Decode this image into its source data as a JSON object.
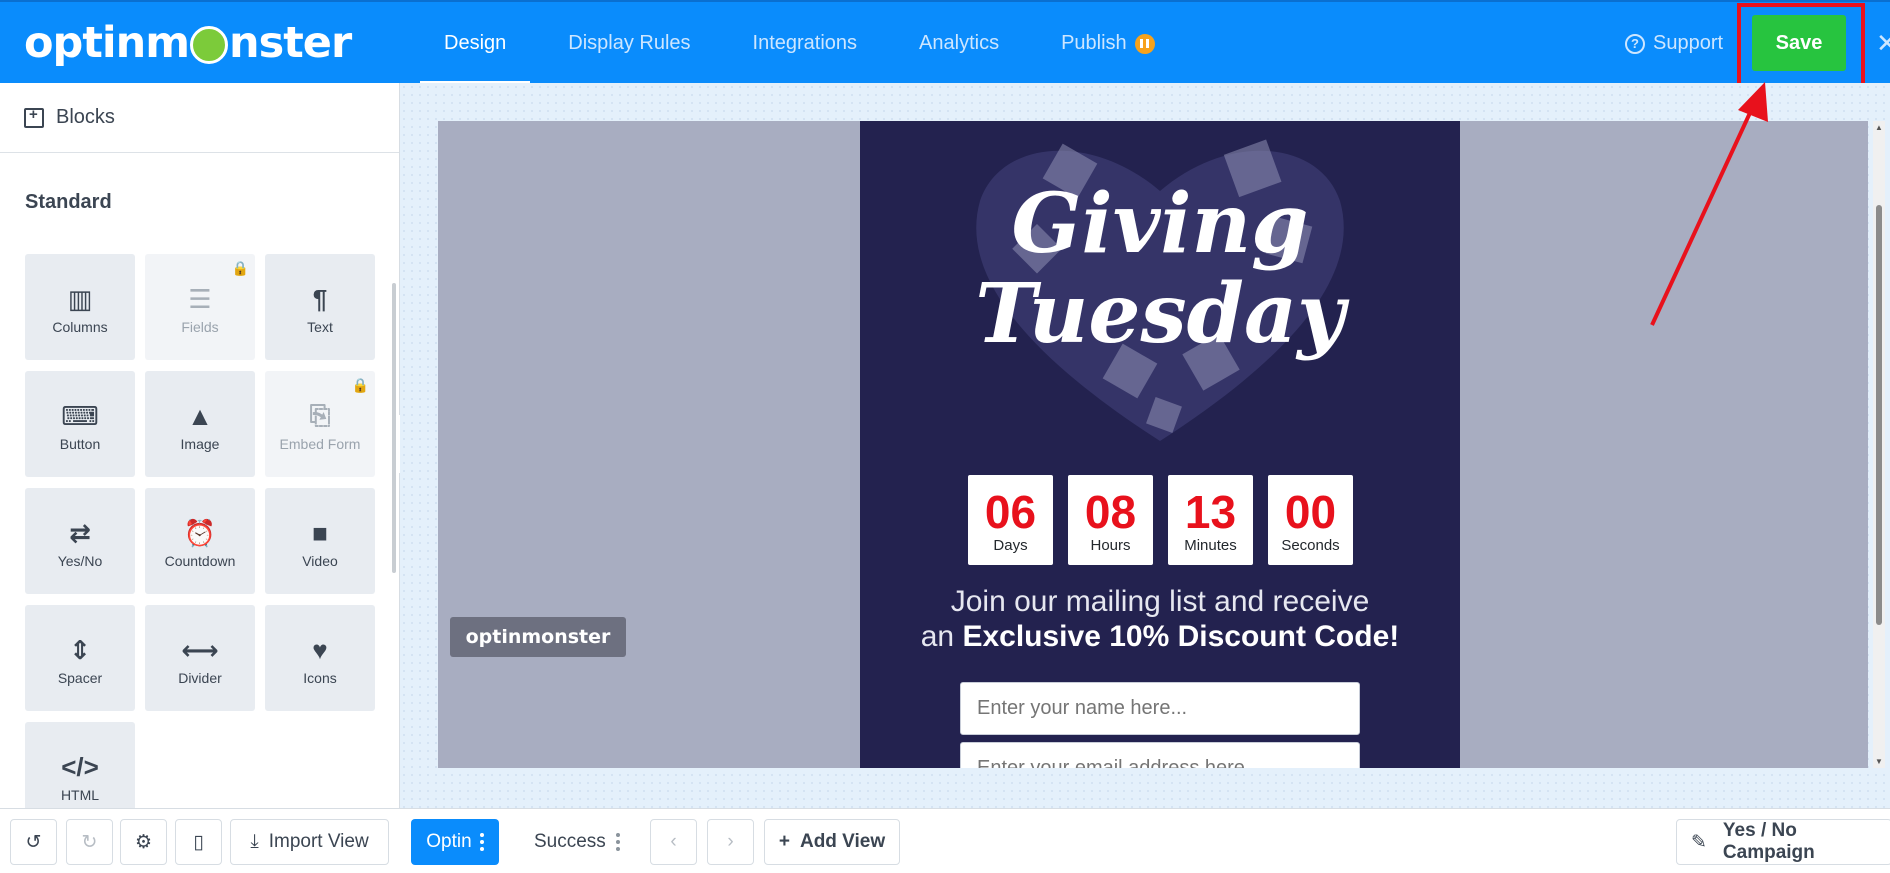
{
  "brand": {
    "logo_text_a": "optinm",
    "logo_text_b": "nster"
  },
  "nav": {
    "tabs": [
      {
        "label": "Design"
      },
      {
        "label": "Display Rules"
      },
      {
        "label": "Integrations"
      },
      {
        "label": "Analytics"
      },
      {
        "label": "Publish"
      }
    ]
  },
  "header": {
    "support_label": "Support",
    "save_label": "Save",
    "close_icon": "✕"
  },
  "sidebar": {
    "heading": "Blocks",
    "section": "Standard",
    "blocks": [
      {
        "label": "Columns",
        "icon": "columns-icon",
        "glyph": "▥",
        "locked": false
      },
      {
        "label": "Fields",
        "icon": "fields-icon",
        "glyph": "☰",
        "locked": true
      },
      {
        "label": "Text",
        "icon": "paragraph-icon",
        "glyph": "¶",
        "locked": false
      },
      {
        "label": "Button",
        "icon": "button-cursor-icon",
        "glyph": "⌨",
        "locked": false
      },
      {
        "label": "Image",
        "icon": "image-icon",
        "glyph": "▲",
        "locked": false
      },
      {
        "label": "Embed Form",
        "icon": "embed-file-icon",
        "glyph": "⎘",
        "locked": true
      },
      {
        "label": "Yes/No",
        "icon": "toggle-icon",
        "glyph": "⇄",
        "locked": false
      },
      {
        "label": "Countdown",
        "icon": "alarm-clock-icon",
        "glyph": "⏰",
        "locked": false
      },
      {
        "label": "Video",
        "icon": "video-camera-icon",
        "glyph": "■",
        "locked": false
      },
      {
        "label": "Spacer",
        "icon": "spacer-icon",
        "glyph": "⇕",
        "locked": false
      },
      {
        "label": "Divider",
        "icon": "divider-icon",
        "glyph": "⟷",
        "locked": false
      },
      {
        "label": "Icons",
        "icon": "heart-circle-icon",
        "glyph": "♥",
        "locked": false
      },
      {
        "label": "HTML",
        "icon": "code-icon",
        "glyph": "</>",
        "locked": false
      }
    ]
  },
  "popup": {
    "title_line1": "Giving",
    "title_line2": "Tuesday",
    "timer": [
      {
        "value": "06",
        "label": "Days"
      },
      {
        "value": "08",
        "label": "Hours"
      },
      {
        "value": "13",
        "label": "Minutes"
      },
      {
        "value": "00",
        "label": "Seconds"
      }
    ],
    "msg_line1": "Join our mailing list and receive",
    "msg_line2_prefix": "an ",
    "msg_line2_bold": "Exclusive 10% Discount Code!",
    "name_placeholder": "Enter your name here...",
    "email_placeholder": "Enter your email address here...",
    "badge_text": "optinmonster"
  },
  "bottom": {
    "import_label": "Import View",
    "optin_label": "Optin",
    "success_label": "Success",
    "add_view_label": "Add View",
    "campaign_label": "Yes / No Campaign"
  },
  "colors": {
    "primary": "#0a8cfc",
    "save": "#27c43f",
    "highlight": "#e8111c",
    "popup_bg": "#23224f"
  }
}
